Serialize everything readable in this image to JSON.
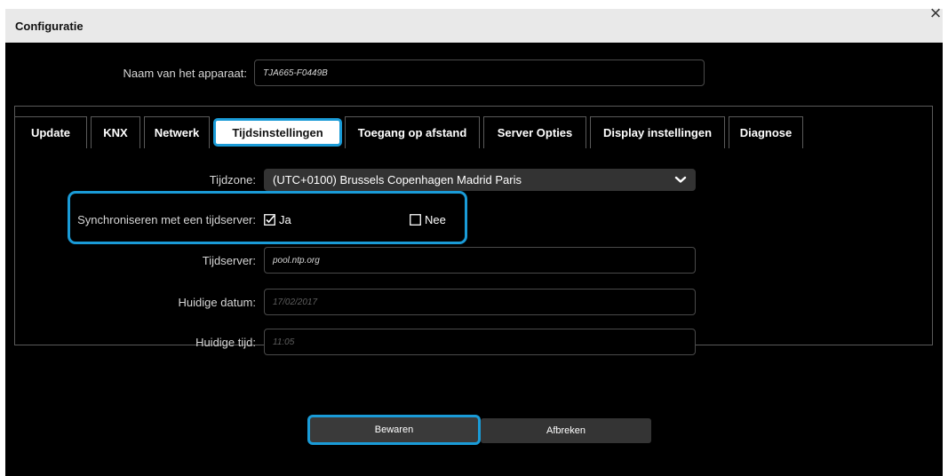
{
  "window": {
    "title": "Configuratie",
    "close_symbol": "×"
  },
  "device": {
    "label": "Naam van het apparaat:",
    "value": "TJA665-F0449B"
  },
  "tabs": [
    {
      "label": "Update"
    },
    {
      "label": "KNX"
    },
    {
      "label": "Netwerk"
    },
    {
      "label": "Tijdsinstellingen",
      "active": true
    },
    {
      "label": "Toegang op afstand"
    },
    {
      "label": "Server Opties"
    },
    {
      "label": "Display instellingen"
    },
    {
      "label": "Diagnose"
    }
  ],
  "form": {
    "timezone": {
      "label": "Tijdzone:",
      "value": "(UTC+0100) Brussels Copenhagen Madrid Paris"
    },
    "sync": {
      "label": "Synchroniseren met een tijdserver:",
      "yes": "Ja",
      "no": "Nee",
      "selected": "Ja"
    },
    "timeserver": {
      "label": "Tijdserver:",
      "value": "pool.ntp.org"
    },
    "date": {
      "label": "Huidige datum:",
      "value": "17/02/2017"
    },
    "time": {
      "label": "Huidige tijd:",
      "value": "11:05"
    }
  },
  "buttons": {
    "save": "Bewaren",
    "cancel": "Afbreken"
  },
  "colors": {
    "accent": "#1a9bd7",
    "background": "#000000",
    "titlebar": "#e9e9e9"
  }
}
